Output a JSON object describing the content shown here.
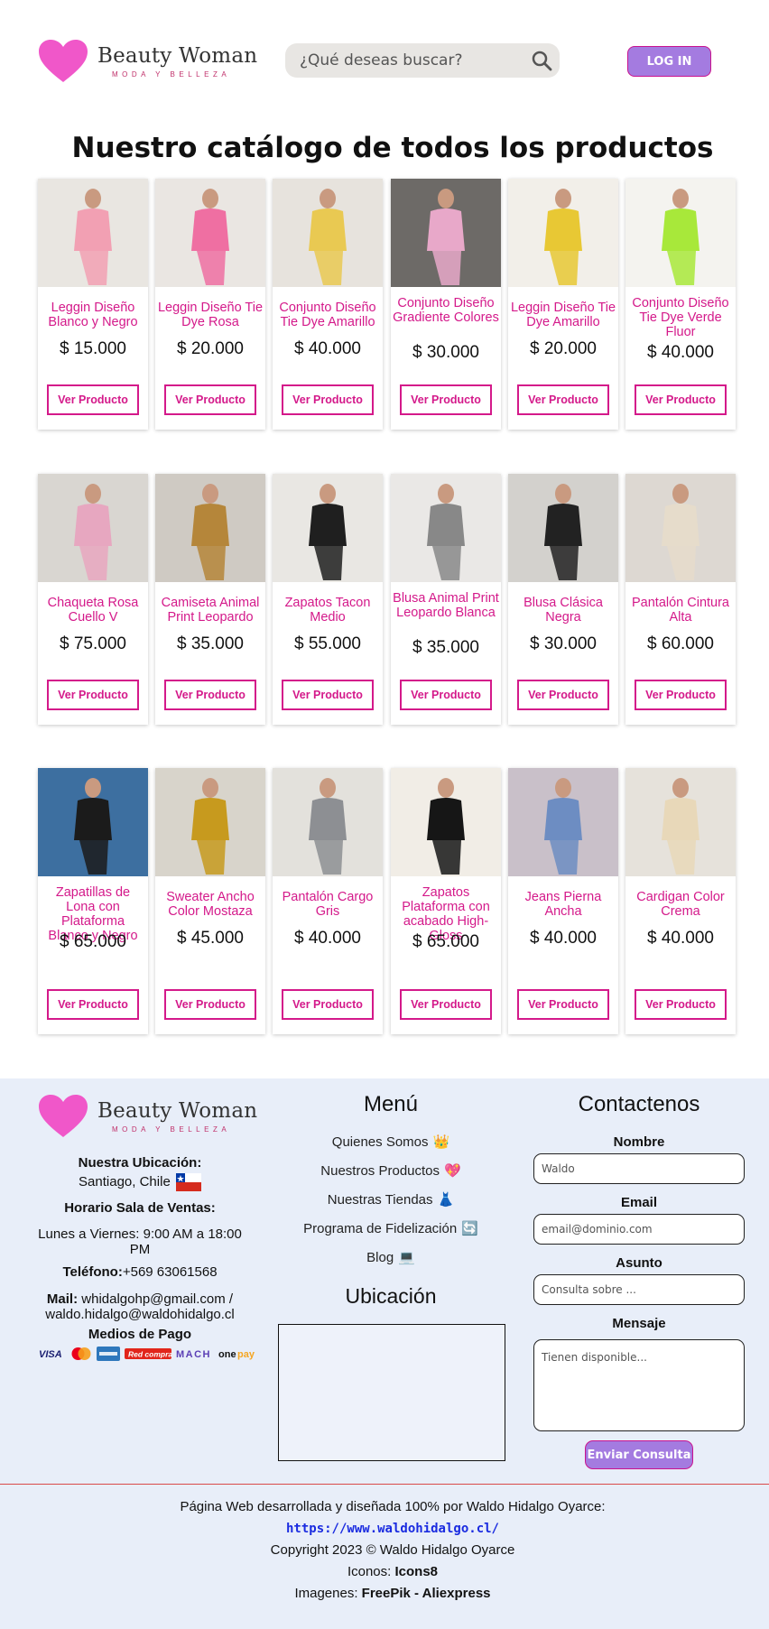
{
  "brand": {
    "name": "Beauty Woman",
    "tagline": "MODA Y BELLEZA",
    "accent_pink": "#f057c9",
    "accent_violet": "#a47be0",
    "product_pink": "#d4198a"
  },
  "header": {
    "search_placeholder": "¿Qué deseas buscar?",
    "login_label": "LOG IN"
  },
  "catalog": {
    "title": "Nuestro catálogo de todos los productos",
    "button_label": "Ver Producto",
    "rows": [
      [
        {
          "name": "Leggin Diseño Blanco y Negro",
          "price": "$ 15.000"
        },
        {
          "name": "Leggin Diseño Tie Dye Rosa",
          "price": "$ 20.000"
        },
        {
          "name": "Conjunto Diseño Tie Dye Amarillo",
          "price": "$ 40.000"
        },
        {
          "name": "Conjunto Diseño Gradiente Colores",
          "price": "$ 30.000"
        },
        {
          "name": "Leggin Diseño Tie Dye Amarillo",
          "price": "$ 20.000"
        },
        {
          "name": "Conjunto Diseño Tie Dye Verde Fluor",
          "price": "$ 40.000"
        }
      ],
      [
        {
          "name": "Chaqueta Rosa Cuello V",
          "price": "$ 75.000"
        },
        {
          "name": "Camiseta Animal Print Leopardo",
          "price": "$ 35.000"
        },
        {
          "name": "Zapatos Tacon Medio",
          "price": "$ 55.000"
        },
        {
          "name": "Blusa Animal Print Leopardo Blanca",
          "price": "$ 35.000"
        },
        {
          "name": "Blusa Clásica Negra",
          "price": "$ 30.000"
        },
        {
          "name": "Pantalón Cintura Alta",
          "price": "$ 60.000"
        }
      ],
      [
        {
          "name": "Zapatillas de Lona con Plataforma Blanco y Negro",
          "price": "$ 65.000"
        },
        {
          "name": "Sweater Ancho Color Mostaza",
          "price": "$ 45.000"
        },
        {
          "name": "Pantalón Cargo Gris",
          "price": "$ 40.000"
        },
        {
          "name": "Zapatos Plataforma con acabado High-Gloss",
          "price": "$ 65.000"
        },
        {
          "name": "Jeans Pierna Ancha",
          "price": "$ 40.000"
        },
        {
          "name": "Cardigan Color Crema",
          "price": "$ 40.000"
        }
      ]
    ]
  },
  "footer": {
    "location_label": "Nuestra Ubicación:",
    "location_value": "Santiago, Chile",
    "hours_label": "Horario Sala de Ventas:",
    "hours_value": "Lunes a Viernes: 9:00 AM a 18:00 PM",
    "phone_label": "Teléfono:",
    "phone_value": "+569 63061568",
    "mail_label": "Mail:",
    "mail_value": "whidalgohp@gmail.com / waldo.hidalgo@waldohidalgo.cl",
    "payment_label": "Medios de Pago",
    "payment_methods": [
      "VISA",
      "Mastercard",
      "American Express",
      "RedCompra",
      "MACH",
      "onepay"
    ],
    "menu_title": "Menú",
    "menu_items": [
      {
        "label": "Quienes Somos",
        "emoji": "👑"
      },
      {
        "label": "Nuestros Productos",
        "emoji": "💖"
      },
      {
        "label": "Nuestras Tiendas",
        "emoji": "👗"
      },
      {
        "label": "Programa de Fidelización",
        "emoji": "🔄"
      },
      {
        "label": "Blog",
        "emoji": "💻"
      }
    ],
    "map_title": "Ubicación",
    "contact_title": "Contactenos",
    "form": {
      "name_label": "Nombre",
      "name_placeholder": "Waldo",
      "email_label": "Email",
      "email_placeholder": "email@dominio.com",
      "subject_label": "Asunto",
      "subject_placeholder": "Consulta sobre ...",
      "message_label": "Mensaje",
      "message_placeholder": "Tienen disponible...",
      "submit_label": "Enviar Consulta"
    },
    "credits": {
      "line1": "Página Web desarrollada y diseñada 100% por Waldo Hidalgo Oyarce:",
      "link": "https://www.waldohidalgo.cl/",
      "copyright": "Copyright 2023 © Waldo Hidalgo Oyarce",
      "icons_label": "Iconos:",
      "icons_value": "Icons8",
      "images_label": "Imagenes:",
      "images_value": "FreePik - Aliexpress"
    }
  }
}
